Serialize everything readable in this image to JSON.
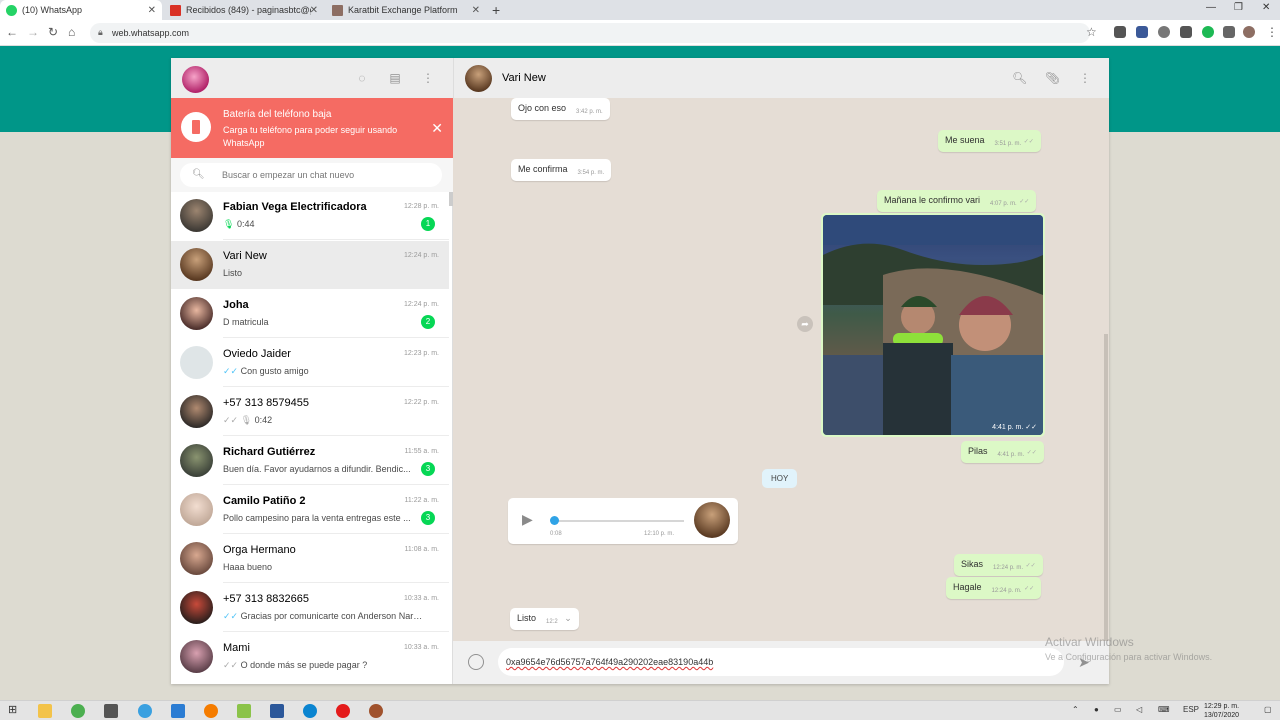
{
  "browser": {
    "tabs": [
      {
        "title": "(10) WhatsApp",
        "favicon_color": "#25d366"
      },
      {
        "title": "Recibidos (849) - paginasbtc@gr",
        "favicon_color": "#d93025"
      },
      {
        "title": "Karatbit Exchange Platform",
        "favicon_color": "#8d6e63"
      }
    ],
    "new_tab": "+",
    "url": "web.whatsapp.com"
  },
  "sidebar": {
    "battery_title": "Batería del teléfono baja",
    "battery_text": "Carga tu teléfono para poder seguir usando WhatsApp",
    "search_placeholder": "Buscar o empezar un chat nuevo",
    "chats": [
      {
        "name": "Fabian Vega Electrificadora",
        "time": "12:28 p. m.",
        "preview": "0:44",
        "badge": "1",
        "bold": true
      },
      {
        "name": "Vari New",
        "time": "12:24 p. m.",
        "preview": "Listo",
        "badge": "",
        "bold": false
      },
      {
        "name": "Joha",
        "time": "12:24 p. m.",
        "preview": "D matricula",
        "badge": "2",
        "bold": true
      },
      {
        "name": "Oviedo Jaider",
        "time": "12:23 p. m.",
        "preview": "Con gusto amigo",
        "badge": "",
        "bold": false
      },
      {
        "name": "+57 313 8579455",
        "time": "12:22 p. m.",
        "preview": "0:42",
        "badge": "",
        "bold": false
      },
      {
        "name": "Richard Gutiérrez",
        "time": "11:55 a. m.",
        "preview": "Buen día. Favor ayudarnos a difundir. Bendic...",
        "badge": "3",
        "bold": true
      },
      {
        "name": "Camilo Patiño 2",
        "time": "11:22 a. m.",
        "preview": "Pollo campesino para la venta entregas este ...",
        "badge": "3",
        "bold": true
      },
      {
        "name": "Orga Hermano",
        "time": "11:08 a. m.",
        "preview": "Haaa bueno",
        "badge": "",
        "bold": false
      },
      {
        "name": "+57 313 8832665",
        "time": "10:33 a. m.",
        "preview": "Gracias por comunicarte con Anderson Narvá...",
        "badge": "",
        "bold": false
      },
      {
        "name": "Mami",
        "time": "10:33 a. m.",
        "preview": "O donde más se puede pagar ?",
        "badge": "",
        "bold": false
      }
    ]
  },
  "conversation": {
    "contact_name": "Vari New",
    "messages": [
      {
        "text": "Ojo con eso",
        "time": "3:42 p. m."
      },
      {
        "text": "Me suena",
        "time": "3:51 p. m."
      },
      {
        "text": "Me confirma",
        "time": "3:54 p. m."
      },
      {
        "text": "Mañana le confirmo vari",
        "time": "4:07 p. m."
      },
      {
        "text": "Pilas",
        "time": "4:41 p. m."
      },
      {
        "text": "Sikas",
        "time": "12:24 p. m."
      },
      {
        "text": "Hagale",
        "time": "12:24 p. m."
      },
      {
        "text": "Listo",
        "time": "12:2"
      }
    ],
    "photo_time": "4:41 p. m.",
    "day_label": "HOY",
    "audio": {
      "duration": "0:08",
      "time": "12:10 p. m."
    },
    "compose_text": "0xa9654e76d56757a764f49a290202eae83190a44b"
  },
  "watermark": {
    "line1": "Activar Windows",
    "line2": "Ve a Configuración para activar Windows."
  },
  "taskbar": {
    "lang": "ESP",
    "time": "12:29 p. m.",
    "date": "13/07/2020"
  }
}
